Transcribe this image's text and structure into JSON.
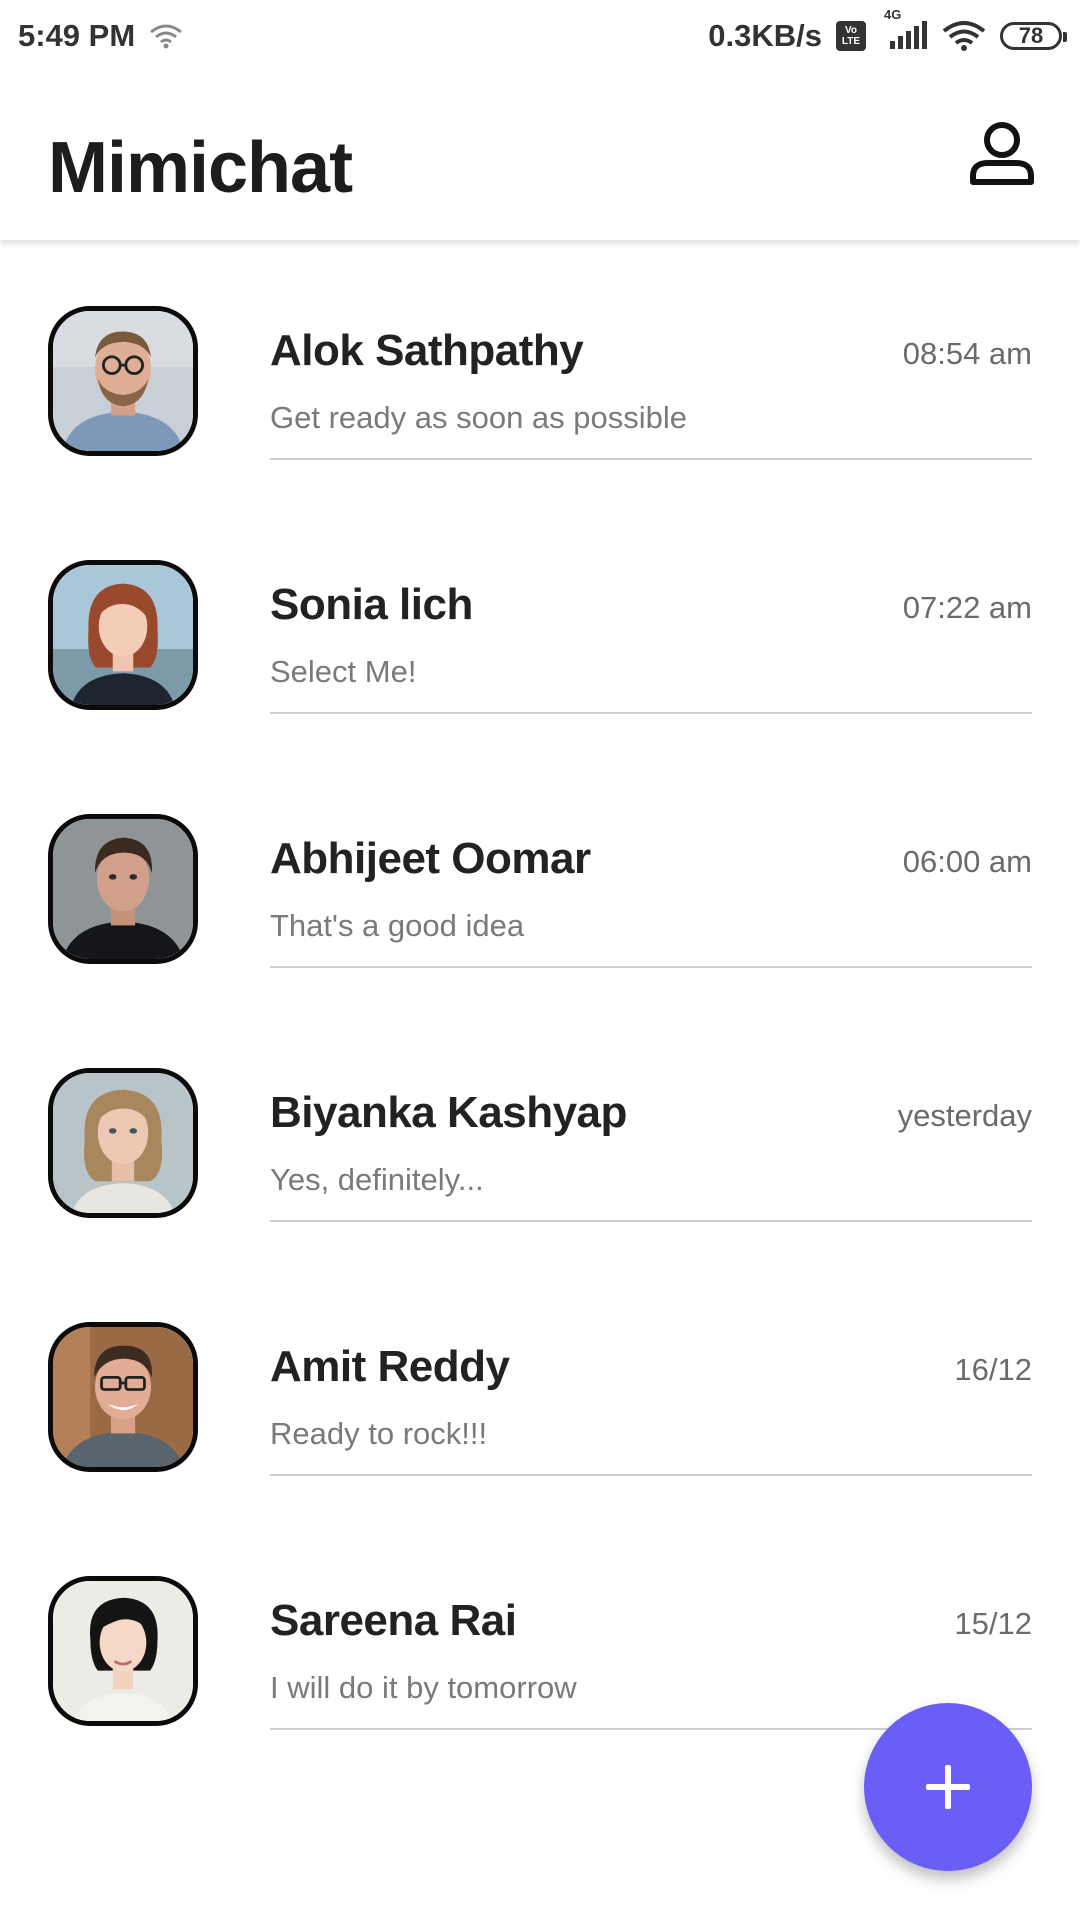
{
  "status_bar": {
    "time": "5:49 PM",
    "net_speed": "0.3KB/s",
    "network": "4G",
    "volte": [
      "Vo",
      "LTE"
    ],
    "battery": "78",
    "icons": [
      "wifi-icon",
      "volte-icon",
      "signal-icon",
      "wifi-icon",
      "battery-icon"
    ]
  },
  "app_bar": {
    "title": "Mimichat",
    "profile_icon": "person-icon"
  },
  "chats": [
    {
      "name": "Alok Sathpathy",
      "time": "08:54 am",
      "preview": "Get ready as soon as possible"
    },
    {
      "name": "Sonia lich",
      "time": "07:22 am",
      "preview": "Select Me!"
    },
    {
      "name": "Abhijeet Oomar",
      "time": "06:00 am",
      "preview": "That's a good idea"
    },
    {
      "name": "Biyanka Kashyap",
      "time": "yesterday",
      "preview": "Yes, definitely..."
    },
    {
      "name": "Amit Reddy",
      "time": "16/12",
      "preview": "Ready to rock!!!"
    },
    {
      "name": "Sareena Rai",
      "time": "15/12",
      "preview": "I will do it by tomorrow"
    }
  ],
  "fab": {
    "icon": "plus-icon"
  },
  "colors": {
    "accent": "#6b5ef7",
    "divider": "#cfcfcf",
    "avatar_border": "#0b0b0b"
  }
}
